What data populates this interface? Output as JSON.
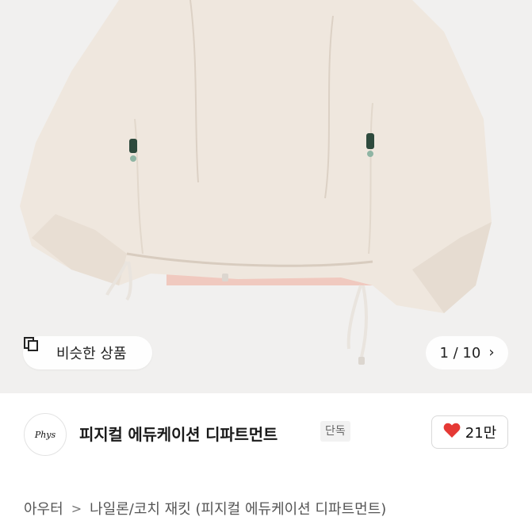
{
  "product_image": {
    "similar_button_label": "비슷한 상품",
    "pager_text": "1 / 10",
    "colors": {
      "background": "#f1f0ef",
      "jacket": "#efe7de",
      "lining": "#f2cfc6"
    }
  },
  "brand": {
    "logo_text": "Phys",
    "name": "피지컬 에듀케이션 디파트먼트",
    "badge": "단독",
    "likes": "21만",
    "heart_color": "#e53935"
  },
  "breadcrumb": {
    "category": "아우터",
    "separator": ">",
    "subcategory": "나일론/코치 재킷 (피지컬 에듀케이션 디파트먼트)"
  }
}
